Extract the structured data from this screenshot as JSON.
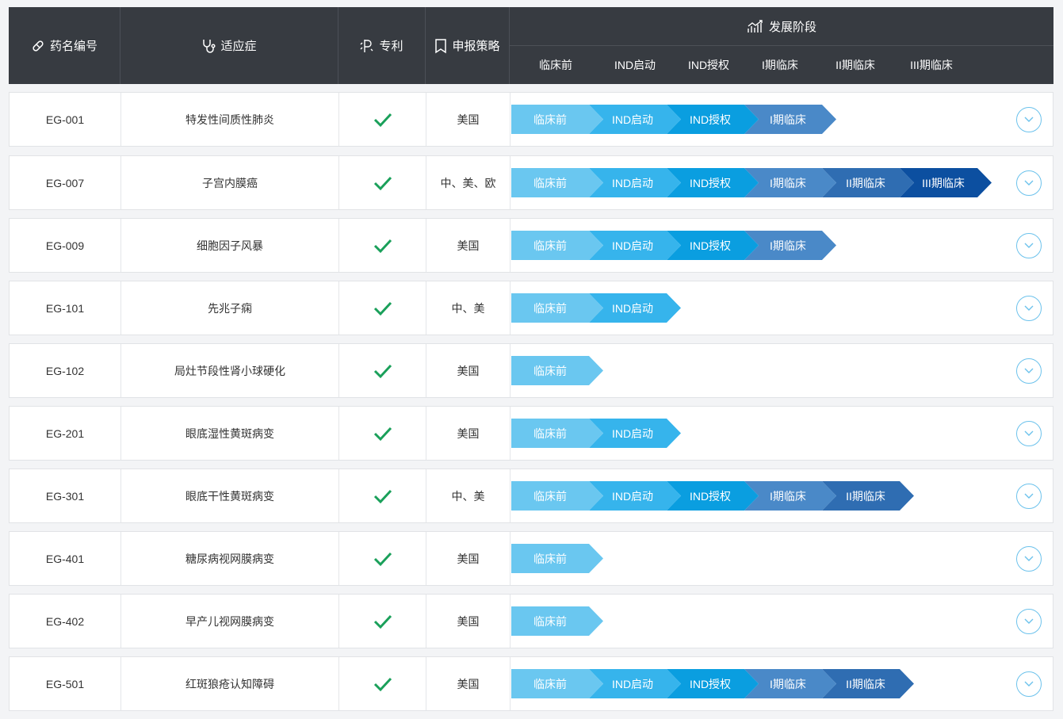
{
  "header": {
    "drug_code": "药名编号",
    "indication": "适应症",
    "patent": "专利",
    "filing_strategy": "申报策略",
    "stage_title": "发展阶段",
    "stages": [
      "临床前",
      "IND启动",
      "IND授权",
      "I期临床",
      "II期临床",
      "III期临床"
    ]
  },
  "stage_colors": [
    "#6ac7f0",
    "#36b4ec",
    "#0a9ee0",
    "#4a89c8",
    "#2f6db2",
    "#0c4fa0"
  ],
  "colors": {
    "header_bg": "#373b41",
    "check": "#1aa05a",
    "expand_ring": "#6cc2ec"
  },
  "icons": {
    "drug_code": "pill-icon",
    "indication": "stethoscope-icon",
    "patent": "patent-icon",
    "filing_strategy": "bookmark-icon",
    "stage": "growth-chart-icon",
    "patent_status": "check-icon",
    "expand": "chevron-down-icon"
  },
  "rows": [
    {
      "code": "EG-001",
      "indication": "特发性间质性肺炎",
      "strategy": "美国",
      "stage_count": 4
    },
    {
      "code": "EG-007",
      "indication": "子宫内膜癌",
      "strategy": "中、美、欧",
      "stage_count": 6
    },
    {
      "code": "EG-009",
      "indication": "细胞因子风暴",
      "strategy": "美国",
      "stage_count": 4
    },
    {
      "code": "EG-101",
      "indication": "先兆子痫",
      "strategy": "中、美",
      "stage_count": 2
    },
    {
      "code": "EG-102",
      "indication": "局灶节段性肾小球硬化",
      "strategy": "美国",
      "stage_count": 1
    },
    {
      "code": "EG-201",
      "indication": "眼底湿性黄斑病变",
      "strategy": "美国",
      "stage_count": 2
    },
    {
      "code": "EG-301",
      "indication": "眼底干性黄斑病变",
      "strategy": "中、美",
      "stage_count": 5
    },
    {
      "code": "EG-401",
      "indication": "糖尿病视网膜病变",
      "strategy": "美国",
      "stage_count": 1
    },
    {
      "code": "EG-402",
      "indication": "早产儿视网膜病变",
      "strategy": "美国",
      "stage_count": 1
    },
    {
      "code": "EG-501",
      "indication": "红斑狼疮认知障碍",
      "strategy": "美国",
      "stage_count": 5
    }
  ]
}
